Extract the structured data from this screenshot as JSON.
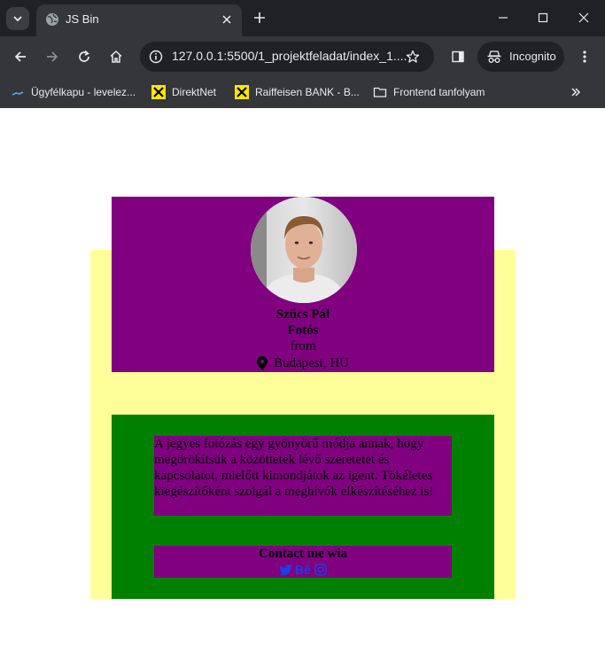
{
  "browser": {
    "tab_title": "JS Bin",
    "url": "127.0.0.1:5500/1_projektfeladat/index_1....",
    "incognito_label": "Incognito",
    "bookmarks": [
      {
        "label": "Ügyfélkapu - levelez...",
        "icon": "ugyfelkapu-icon"
      },
      {
        "label": "DirektNet",
        "icon": "raiffeisen-logo-icon"
      },
      {
        "label": "Raiffeisen BANK - B...",
        "icon": "raiffeisen-logo-icon"
      },
      {
        "label": "Frontend tanfolyam",
        "icon": "folder-icon"
      }
    ]
  },
  "profile": {
    "name": "Szűcs Pál",
    "job": "Fotós",
    "from_label": "from",
    "location": "Budapest, HU"
  },
  "about": {
    "text": "A jegyes fotózás egy gyönyörű módja annak, hogy megörökítsük a közöttetek lévő szeretetet és kapcsolatot, mielőtt kimondjátok az igent. Tökéletes kiegészítőként szolgál a meghívók elkészítéséhez is!"
  },
  "contact": {
    "title": "Contact me wia",
    "socials": [
      {
        "name": "twitter",
        "icon": "twitter-icon"
      },
      {
        "name": "behance",
        "label": "Bē",
        "icon": "behance-icon"
      },
      {
        "name": "instagram",
        "icon": "instagram-icon"
      }
    ]
  },
  "colors": {
    "card_purple": "#800080",
    "yellow_bg": "#ffff99",
    "green_card": "#008000",
    "link_blue": "#1c3fe0"
  }
}
